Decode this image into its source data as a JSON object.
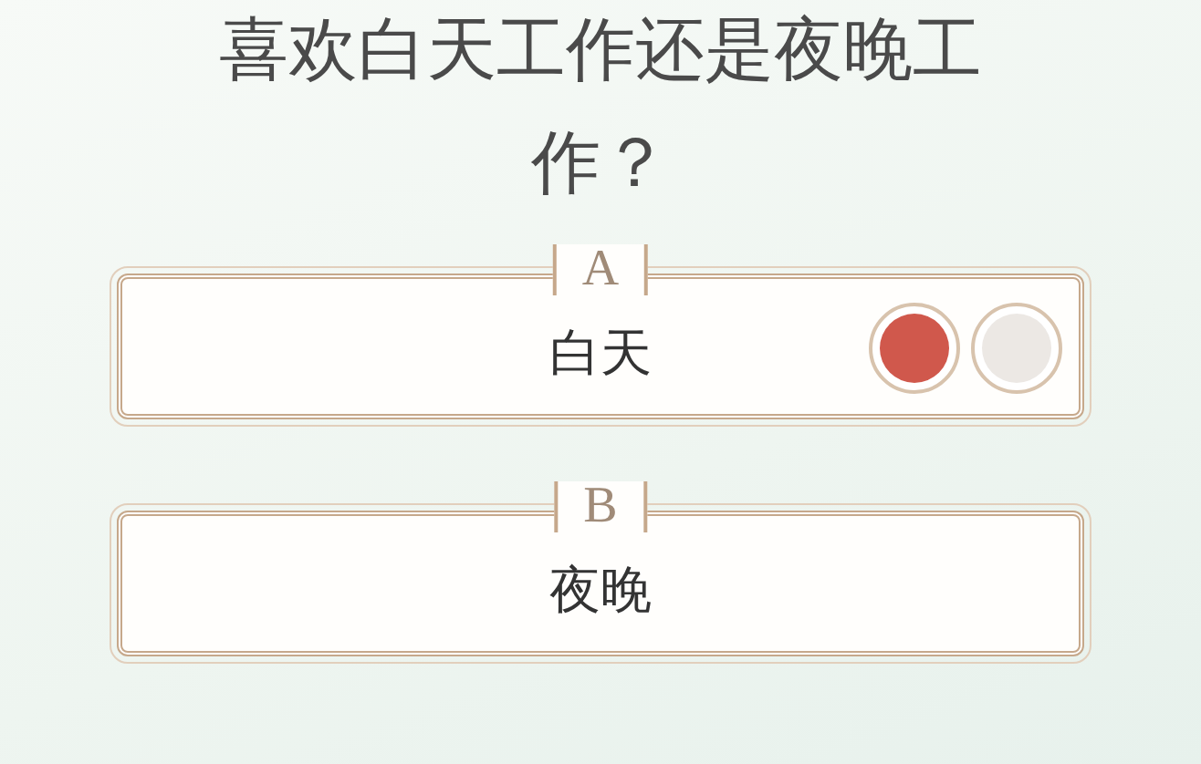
{
  "question": {
    "text": "喜欢白天工作还是夜晚工作？"
  },
  "options": [
    {
      "letter": "A",
      "text": "白天",
      "avatars": [
        {
          "color": "#d0584c"
        },
        {
          "color": "#ece8e4"
        }
      ]
    },
    {
      "letter": "B",
      "text": "夜晚"
    }
  ]
}
